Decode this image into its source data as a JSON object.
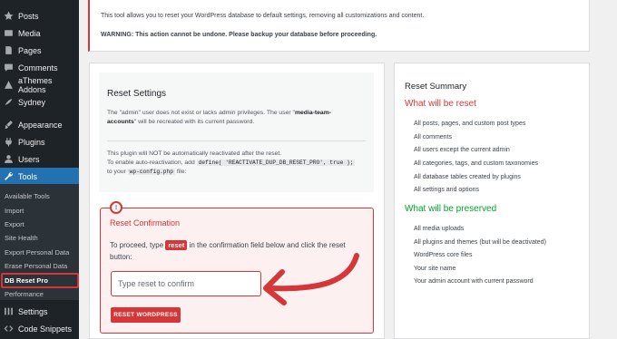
{
  "sidebar": {
    "items": [
      {
        "label": "Posts",
        "icon": "pin-icon"
      },
      {
        "label": "Media",
        "icon": "media-icon"
      },
      {
        "label": "Pages",
        "icon": "page-icon"
      },
      {
        "label": "Comments",
        "icon": "comments-icon"
      },
      {
        "label": "aThemes Addons",
        "icon": "addons-icon"
      },
      {
        "label": "Sydney",
        "icon": "sydney-icon"
      },
      {
        "label": "Appearance",
        "icon": "brush-icon"
      },
      {
        "label": "Plugins",
        "icon": "plugin-icon"
      },
      {
        "label": "Users",
        "icon": "users-icon"
      },
      {
        "label": "Tools",
        "icon": "wrench-icon"
      },
      {
        "label": "Settings",
        "icon": "settings-icon"
      },
      {
        "label": "Code Snippets",
        "icon": "code-snippets-icon"
      }
    ],
    "submenu": [
      "Available Tools",
      "Import",
      "Export",
      "Site Health",
      "Export Personal Data",
      "Erase Personal Data",
      "DB Reset Pro",
      "Performance"
    ]
  },
  "top_notice": {
    "line1": "This tool allows you to reset your WordPress database to default settings, removing all customizations and content.",
    "warning": "WARNING: This action cannot be undone. Please backup your database before proceeding."
  },
  "reset_settings": {
    "title": "Reset Settings",
    "p1_a": "The \"admin\" user does not exist or lacks admin privileges. The user \"",
    "p1_user": "media-team-",
    "p1_user2": "accounts",
    "p1_b": "\" will be recreated with its current password.",
    "p2_line1": "This plugin will NOT be automatically reactivated after the reset.",
    "p2_line2_a": "To enable auto-reactivation, add",
    "p2_code1": "define( 'REACTIVATE_DUP_DB_RESET_PRO', true );",
    "p2_line3_a": "to your",
    "p2_code2": "wp-config.php",
    "p2_line3_b": "file:"
  },
  "confirmation": {
    "badge": "!",
    "title": "Reset Confirmation",
    "text_a": "To proceed, type",
    "keyword": "reset",
    "text_b": "in the confirmation field below and click the reset",
    "text_c": "button:",
    "input_placeholder": "Type reset to confirm",
    "input_value": "",
    "button_label": "RESET WORDPRESS"
  },
  "summary": {
    "title": "Reset Summary",
    "reset_heading": "What will be reset",
    "reset_items": [
      "All posts, pages, and custom post types",
      "All comments",
      "All users except the current admin",
      "All categories, tags, and custom taxonomies",
      "All database tables created by plugins",
      "All settings and options"
    ],
    "preserve_heading": "What will be preserved",
    "preserve_items": [
      "All media uploads",
      "All plugins and themes (but will be deactivated)",
      "WordPress core files",
      "Your site name",
      "Your admin account with current password"
    ]
  },
  "colors": {
    "accent": "#2271b1",
    "danger": "#d63638",
    "success": "#00a32a",
    "sidebar": "#1d2327"
  }
}
